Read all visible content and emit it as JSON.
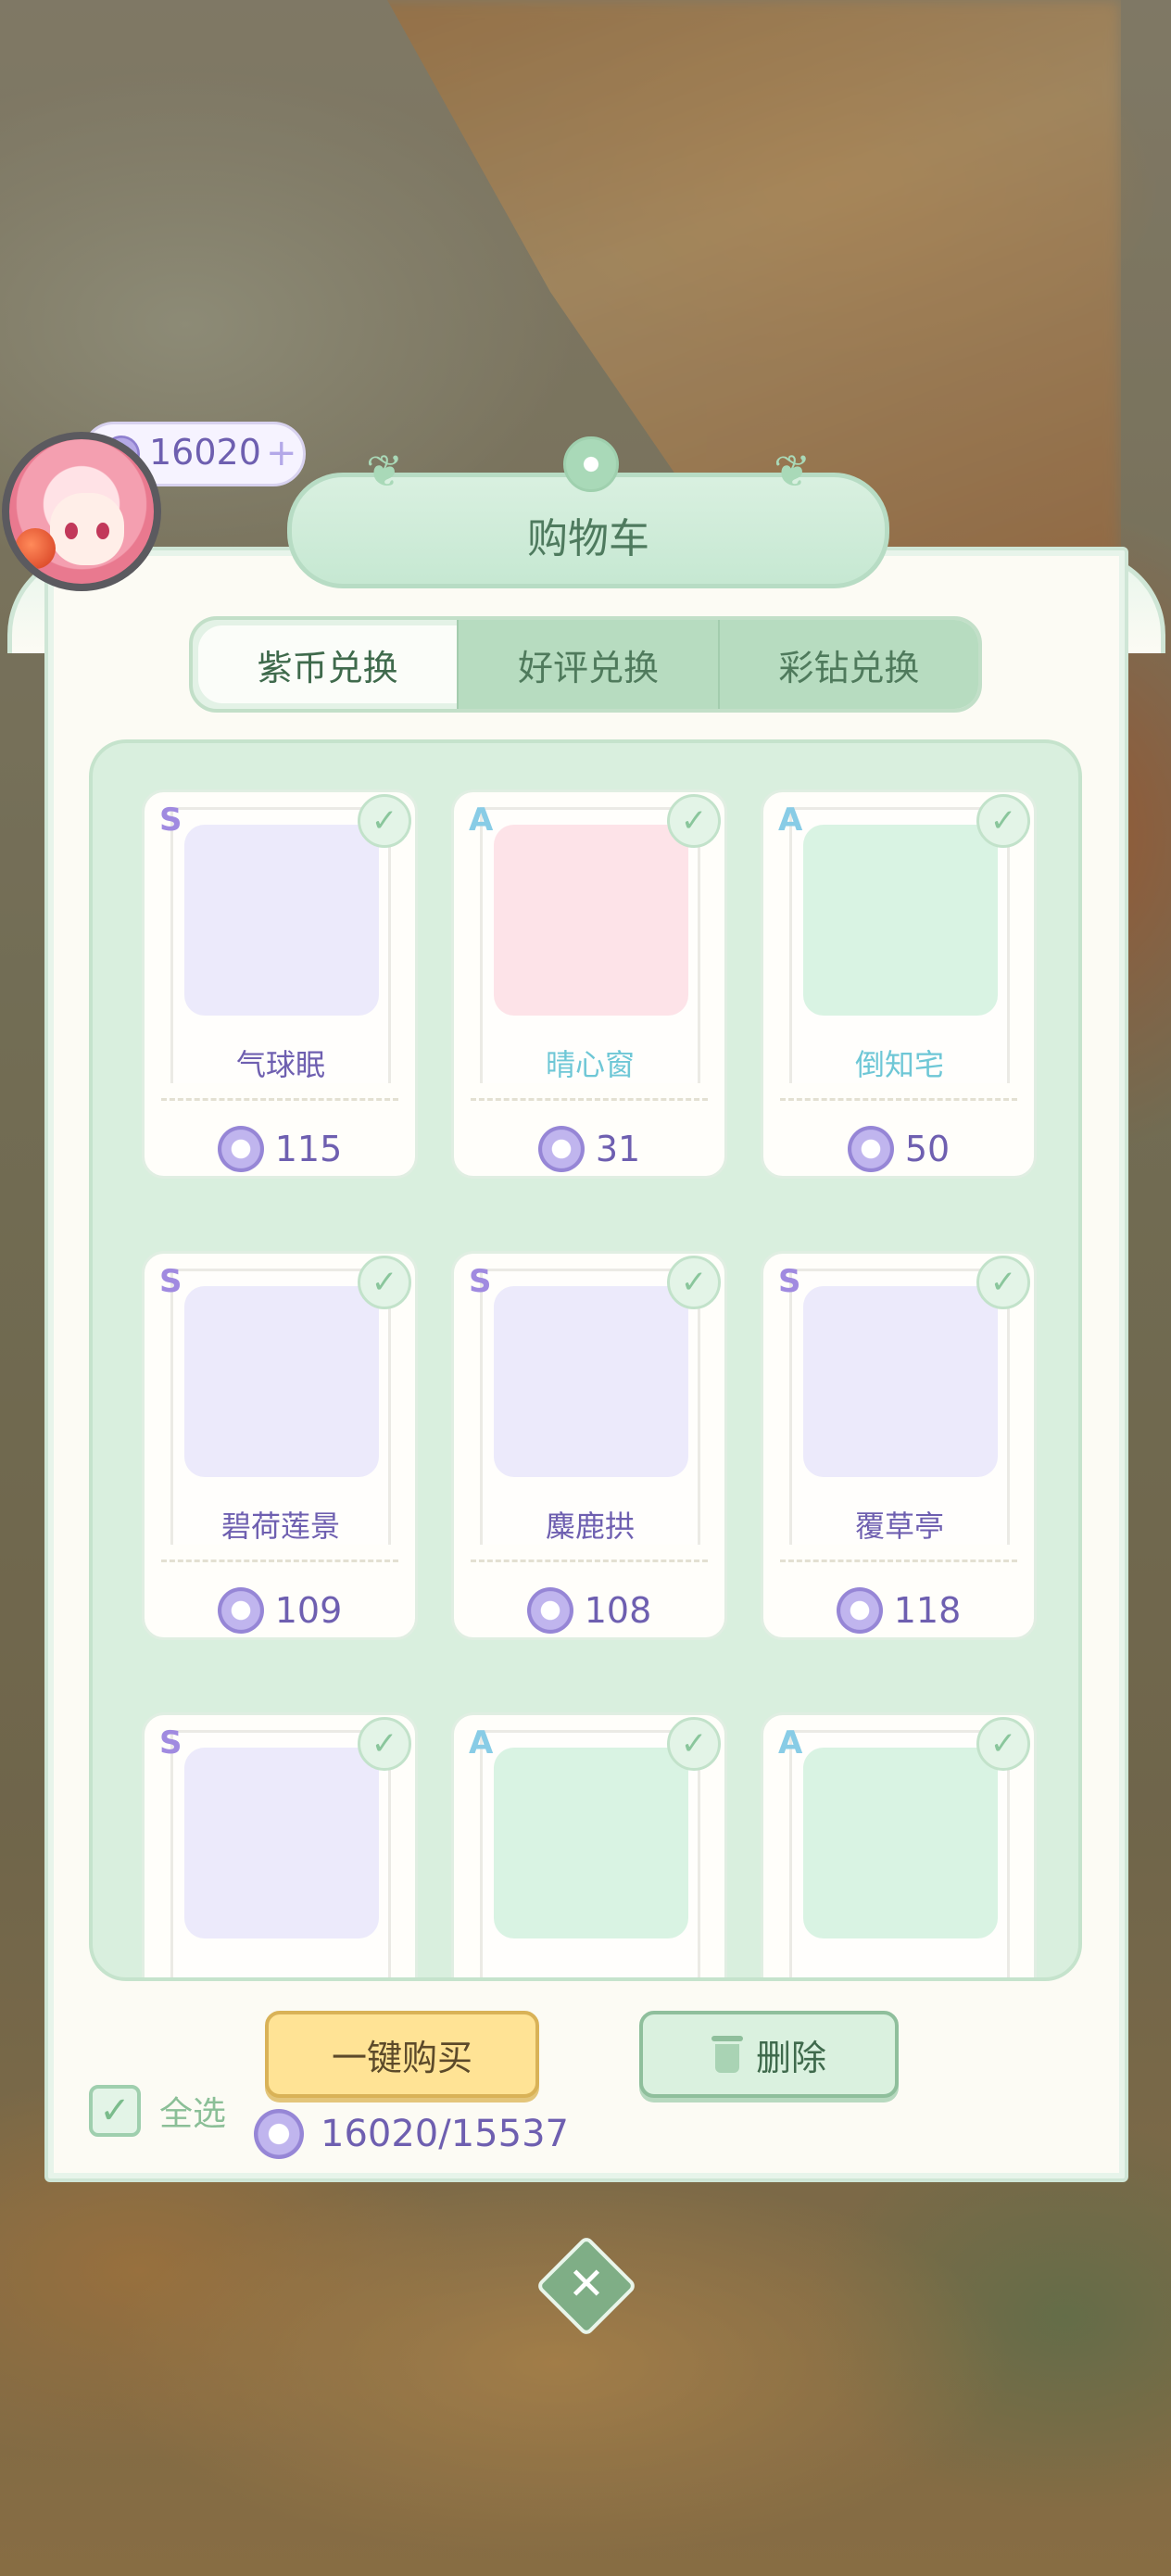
{
  "header": {
    "currency_amount": "16020",
    "currency_plus": "+",
    "title": "购物车"
  },
  "tabs": [
    {
      "label": "紫币兑换",
      "active": true
    },
    {
      "label": "好评兑换",
      "active": false
    },
    {
      "label": "彩钻兑换",
      "active": false
    }
  ],
  "items": [
    {
      "rank": "S",
      "name": "气球眠",
      "price": "115",
      "checked": true
    },
    {
      "rank": "A",
      "name": "晴心窗",
      "price": "31",
      "checked": true
    },
    {
      "rank": "A",
      "name": "倒知宅",
      "price": "50",
      "checked": true
    },
    {
      "rank": "S",
      "name": "碧荷莲景",
      "price": "109",
      "checked": true
    },
    {
      "rank": "S",
      "name": "麋鹿拱",
      "price": "108",
      "checked": true
    },
    {
      "rank": "S",
      "name": "覆草亭",
      "price": "118",
      "checked": true
    },
    {
      "rank": "S",
      "name": "",
      "price": "",
      "checked": true
    },
    {
      "rank": "A",
      "name": "",
      "price": "",
      "checked": true
    },
    {
      "rank": "A",
      "name": "",
      "price": "",
      "checked": true
    }
  ],
  "footer": {
    "select_all_label": "全选",
    "buy_label": "一键购买",
    "delete_label": "删除",
    "balance": "16020/15537"
  },
  "colors": {
    "accent_green": "#b7dcc0",
    "coin_purple": "#6e5fb0",
    "buy_yellow": "#ffe395"
  }
}
